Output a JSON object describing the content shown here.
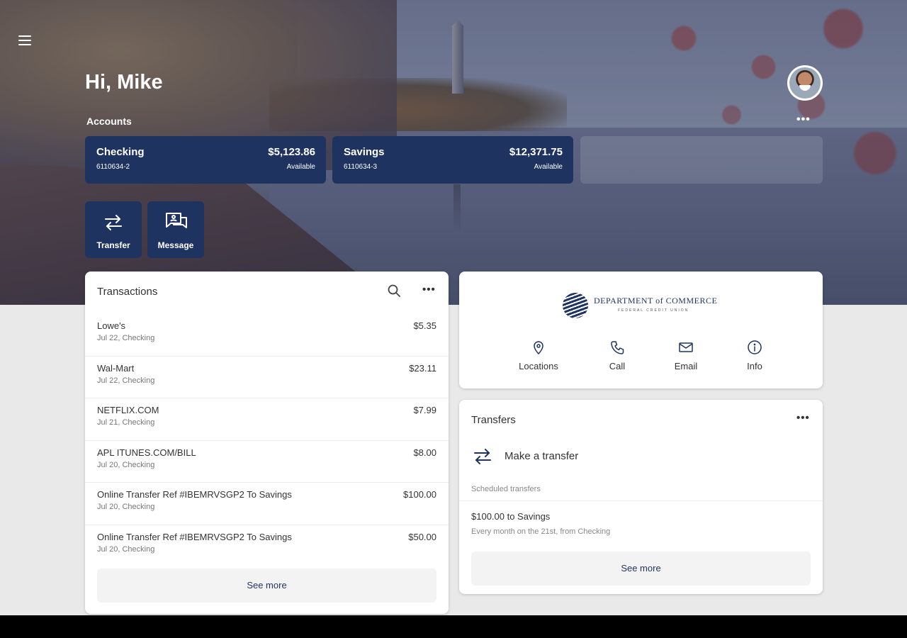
{
  "header": {
    "greeting": "Hi, Mike",
    "accounts_label": "Accounts",
    "accounts_more": "•••"
  },
  "accounts": [
    {
      "name": "Checking",
      "number": "6110634-2",
      "balance": "$5,123.86",
      "status": "Available"
    },
    {
      "name": "Savings",
      "number": "6110634-3",
      "balance": "$12,371.75",
      "status": "Available"
    }
  ],
  "quick_actions": [
    {
      "label": "Transfer",
      "icon": "transfer-icon"
    },
    {
      "label": "Message",
      "icon": "message-icon"
    }
  ],
  "transactions": {
    "title": "Transactions",
    "more": "•••",
    "items": [
      {
        "name": "Lowe's",
        "sub": "Jul 22, Checking",
        "amount": "$5.35"
      },
      {
        "name": "Wal-Mart",
        "sub": "Jul 22, Checking",
        "amount": "$23.11"
      },
      {
        "name": "NETFLIX.COM",
        "sub": "Jul 21, Checking",
        "amount": "$7.99"
      },
      {
        "name": "APL ITUNES.COM/BILL",
        "sub": "Jul 20, Checking",
        "amount": "$8.00"
      },
      {
        "name": "Online Transfer Ref #IBEMRVSGP2 To Savings",
        "sub": "Jul 20, Checking",
        "amount": "$100.00"
      },
      {
        "name": "Online Transfer Ref #IBEMRVSGP2 To Savings",
        "sub": "Jul 20, Checking",
        "amount": "$50.00"
      }
    ],
    "see_more": "See more"
  },
  "institution": {
    "logo_line1": "DEPARTMENT of COMMERCE",
    "logo_line2": "FEDERAL CREDIT UNION",
    "actions": [
      {
        "label": "Locations",
        "icon": "location-pin-icon"
      },
      {
        "label": "Call",
        "icon": "phone-icon"
      },
      {
        "label": "Email",
        "icon": "email-icon"
      },
      {
        "label": "Info",
        "icon": "info-icon"
      }
    ]
  },
  "transfers": {
    "title": "Transfers",
    "more": "•••",
    "make_transfer": "Make a transfer",
    "scheduled_label": "Scheduled transfers",
    "scheduled": {
      "name": "$100.00 to Savings",
      "detail": "Every month on the 21st, from Checking"
    },
    "see_more": "See more"
  },
  "colors": {
    "brand_navy": "#1e335f",
    "page_bg": "#e9e9ea"
  }
}
